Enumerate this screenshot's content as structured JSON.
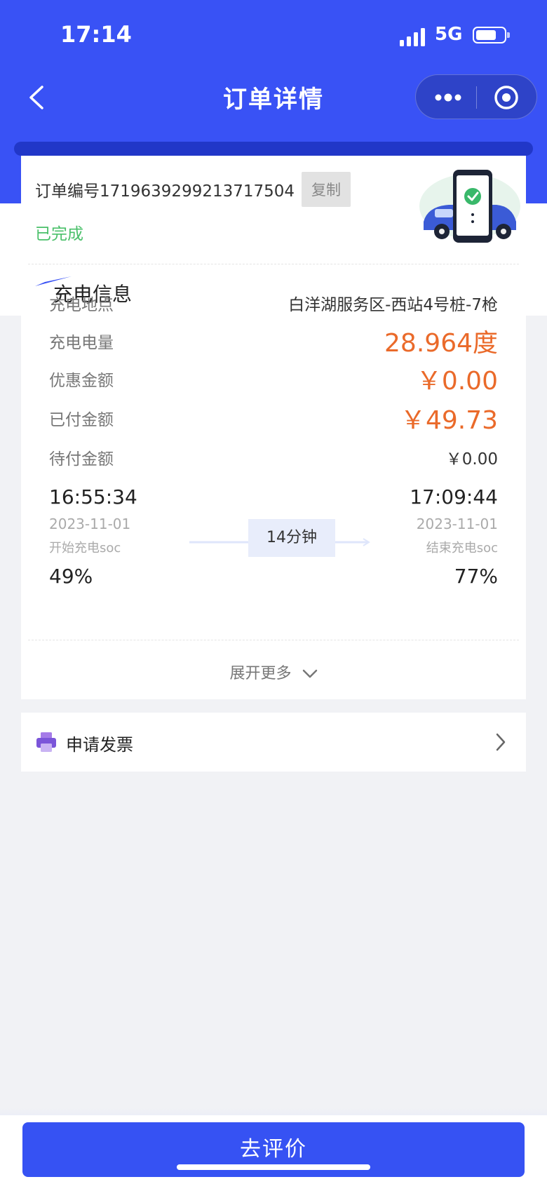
{
  "status_bar": {
    "time": "17:14",
    "network": "5G"
  },
  "nav": {
    "title": "订单详情"
  },
  "order": {
    "number_label": "订单编号1719639299213717504",
    "copy_label": "复制",
    "status": "已完成"
  },
  "section": {
    "title": "充电信息"
  },
  "rows": [
    {
      "label": "充电地点",
      "value": "白洋湖服务区-西站4号桩-7枪"
    },
    {
      "label": "充电电量",
      "value": "28.964度"
    },
    {
      "label": "优惠金额",
      "value": "￥0.00"
    },
    {
      "label": "已付金额",
      "value": "￥49.73"
    },
    {
      "label": "待付金额",
      "value": "￥0.00"
    }
  ],
  "timeline": {
    "start_time": "16:55:34",
    "start_date": "2023-11-01",
    "start_soc_label": "开始充电soc",
    "start_soc": "49%",
    "end_time": "17:09:44",
    "end_date": "2023-11-01",
    "end_soc_label": "结束充电soc",
    "end_soc": "77%",
    "duration": "14分钟"
  },
  "expand_label": "展开更多",
  "invoice": {
    "label": "申请发票"
  },
  "bottom": {
    "review_label": "去评价"
  },
  "colors": {
    "primary": "#3952f5",
    "accent": "#ea6a2a",
    "success": "#4ac06a"
  }
}
